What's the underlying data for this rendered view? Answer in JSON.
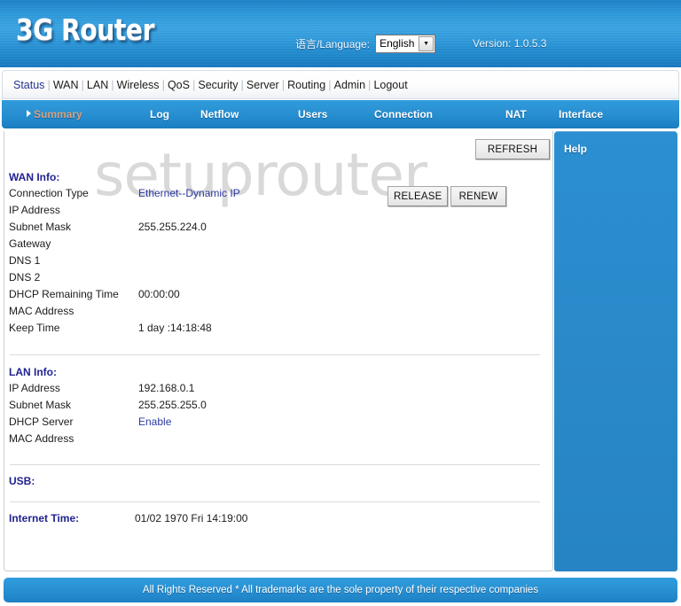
{
  "header": {
    "logo": "3G Router",
    "language_label": "语言/Language:",
    "language_value": "English",
    "language_options": [
      "English"
    ],
    "version": "Version: 1.0.5.3",
    "accent_color": "#2b93d4"
  },
  "main_nav": {
    "items": [
      {
        "label": "Status",
        "active": true
      },
      {
        "label": "WAN",
        "active": false
      },
      {
        "label": "LAN",
        "active": false
      },
      {
        "label": "Wireless",
        "active": false
      },
      {
        "label": "QoS",
        "active": false
      },
      {
        "label": "Security",
        "active": false
      },
      {
        "label": "Server",
        "active": false
      },
      {
        "label": "Routing",
        "active": false
      },
      {
        "label": "Admin",
        "active": false
      },
      {
        "label": "Logout",
        "active": false
      }
    ]
  },
  "sub_nav": {
    "items": [
      {
        "label": "Summary",
        "current": true
      },
      {
        "label": "Log",
        "current": false
      },
      {
        "label": "Netflow",
        "current": false
      },
      {
        "label": "Users",
        "current": false
      },
      {
        "label": "Connection",
        "current": false
      },
      {
        "label": "NAT",
        "current": false
      },
      {
        "label": "Interface",
        "current": false
      }
    ],
    "current_color": "#d8a27e"
  },
  "watermark": "setuprouter",
  "buttons": {
    "refresh": "REFRESH",
    "release": "RELEASE",
    "renew": "RENEW"
  },
  "help_panel": {
    "title": "Help",
    "background_color": "#2a89c9"
  },
  "wan_info": {
    "heading": "WAN Info:",
    "rows": [
      {
        "label": "Connection Type",
        "value": "Ethernet--Dynamic IP",
        "link": true
      },
      {
        "label": "IP Address",
        "value": ""
      },
      {
        "label": "Subnet Mask",
        "value": "255.255.224.0"
      },
      {
        "label": "Gateway",
        "value": ""
      },
      {
        "label": "DNS 1",
        "value": ""
      },
      {
        "label": "DNS 2",
        "value": ""
      },
      {
        "label": "DHCP Remaining Time",
        "value": "00:00:00"
      },
      {
        "label": "MAC Address",
        "value": ""
      },
      {
        "label": "Keep Time",
        "value": "1 day :14:18:48"
      }
    ]
  },
  "lan_info": {
    "heading": "LAN Info:",
    "rows": [
      {
        "label": "IP Address",
        "value": "192.168.0.1"
      },
      {
        "label": "Subnet Mask",
        "value": "255.255.255.0"
      },
      {
        "label": "DHCP Server",
        "value": "Enable",
        "link": true
      },
      {
        "label": "MAC Address",
        "value": ""
      }
    ]
  },
  "usb_info": {
    "heading": "USB:",
    "rows": []
  },
  "internet_time": {
    "heading": "Internet Time:",
    "value": "01/02 1970 Fri 14:19:00"
  },
  "footer": {
    "text": "All Rights Reserved * All trademarks are the sole property of their respective companies"
  }
}
